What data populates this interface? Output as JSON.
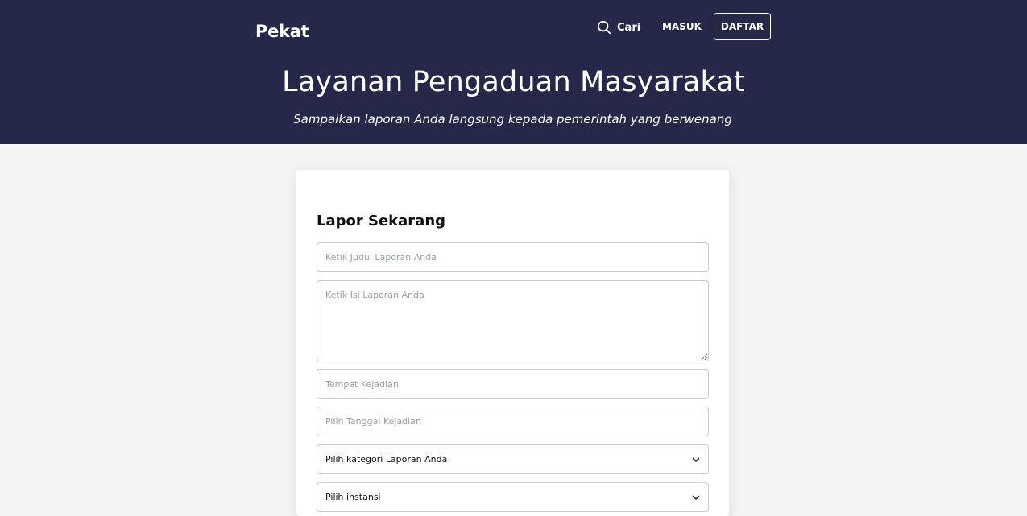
{
  "header": {
    "brand": "Pekat",
    "search_label": "Cari",
    "login_label": "MASUK",
    "register_label": "DAFTAR",
    "background_color": "#252849"
  },
  "hero": {
    "title": "Layanan Pengaduan Masyarakat",
    "subtitle": "Sampaikan laporan Anda langsung kepada pemerintah yang berwenang"
  },
  "form": {
    "title": "Lapor Sekarang",
    "report_title_placeholder": "Ketik Judul Laporan Anda",
    "report_body_placeholder": "Ketik Isi Laporan Anda",
    "location_placeholder": "Tempat Kejadian",
    "date_placeholder": "Pilih Tanggal Kejadian",
    "category_selected": "Pilih kategori Laporan Anda",
    "agency_selected": "Pilih instansi"
  },
  "icons": {
    "search": "search-icon",
    "chevron": "chevron-down-icon"
  }
}
